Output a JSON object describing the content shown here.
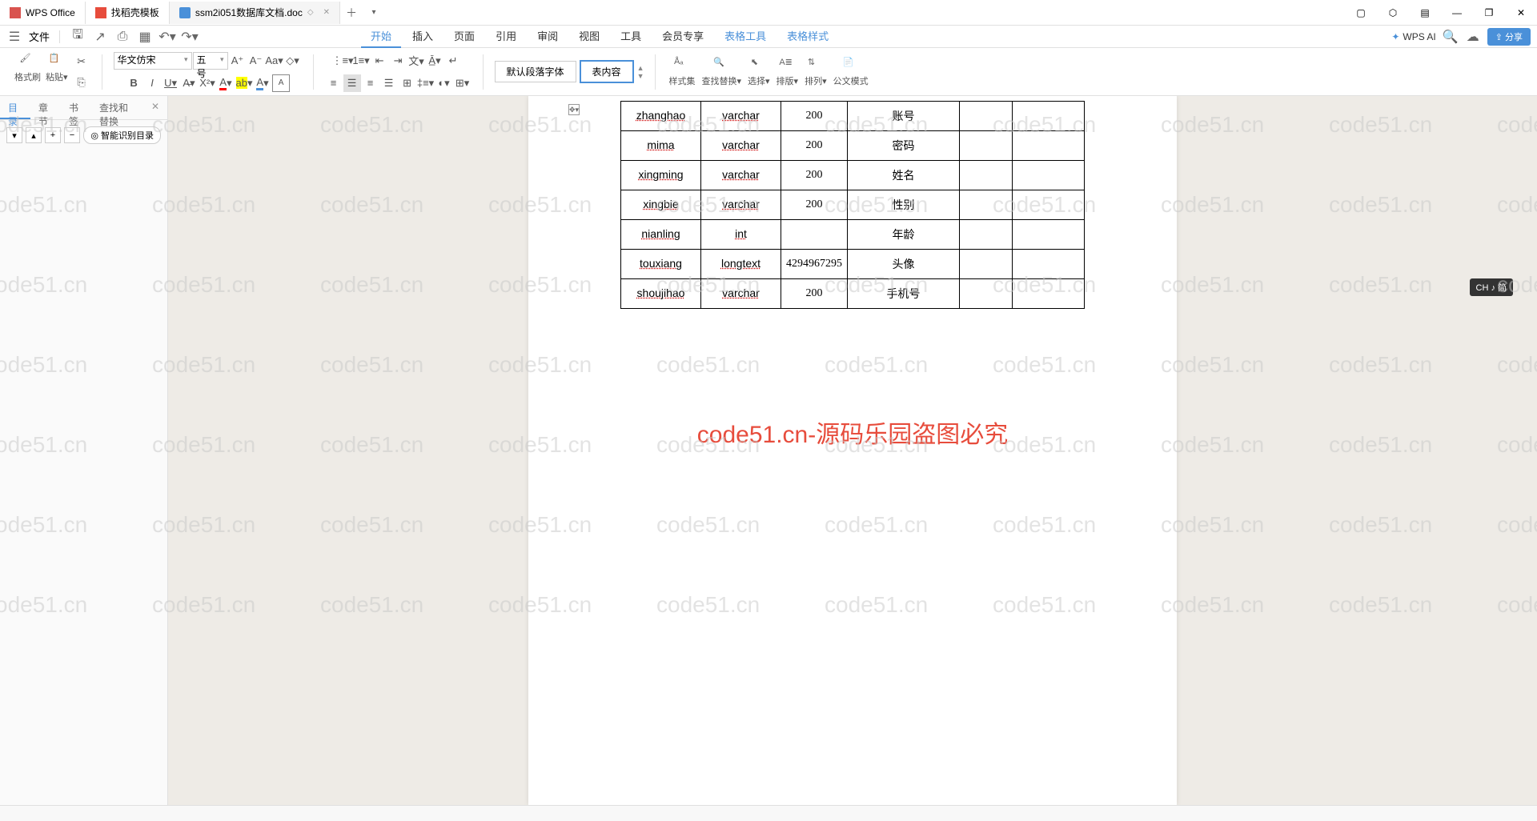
{
  "tabs": {
    "t0": "WPS Office",
    "t1": "找稻壳模板",
    "t2": "ssm2i051数据库文档.doc"
  },
  "menu": {
    "file": "文件",
    "start": "开始",
    "insert": "插入",
    "page": "页面",
    "ref": "引用",
    "review": "审阅",
    "view": "视图",
    "tools": "工具",
    "member": "会员专享",
    "tbltools": "表格工具",
    "tblstyle": "表格样式",
    "wpsai": "WPS AI"
  },
  "ribbon": {
    "fmt": "格式刷",
    "paste": "粘贴",
    "font": "华文仿宋",
    "size": "五号",
    "style_def": "默认段落字体",
    "style_content": "表内容",
    "styleset": "样式集",
    "findrep": "查找替换",
    "select": "选择",
    "arrange": "排版",
    "sort": "排列",
    "docmode": "公文模式",
    "share": "分享"
  },
  "sidebar": {
    "toc": "目录",
    "chapter": "章节",
    "bookmark": "书签",
    "findrep": "查找和替换",
    "smart": "智能识别目录"
  },
  "table": {
    "rows": [
      {
        "c1": "zhanghao",
        "c2": "varchar",
        "c3": "200",
        "c4": "账号",
        "c5": "",
        "c6": ""
      },
      {
        "c1": "mima",
        "c2": "varchar",
        "c3": "200",
        "c4": "密码",
        "c5": "",
        "c6": ""
      },
      {
        "c1": "xingming",
        "c2": "varchar",
        "c3": "200",
        "c4": "姓名",
        "c5": "",
        "c6": ""
      },
      {
        "c1": "xingbie",
        "c2": "varchar",
        "c3": "200",
        "c4": "性别",
        "c5": "",
        "c6": ""
      },
      {
        "c1": "nianling",
        "c2": "int",
        "c3": "",
        "c4": "年龄",
        "c5": "",
        "c6": ""
      },
      {
        "c1": "touxiang",
        "c2": "longtext",
        "c3": "4294967295",
        "c4": "头像",
        "c5": "",
        "c6": ""
      },
      {
        "c1": "shoujihao",
        "c2": "varchar",
        "c3": "200",
        "c4": "手机号",
        "c5": "",
        "c6": ""
      }
    ]
  },
  "overlay": "code51.cn-源码乐园盗图必究",
  "watermark": "code51.cn",
  "float_tag": "CH ♪ 简"
}
